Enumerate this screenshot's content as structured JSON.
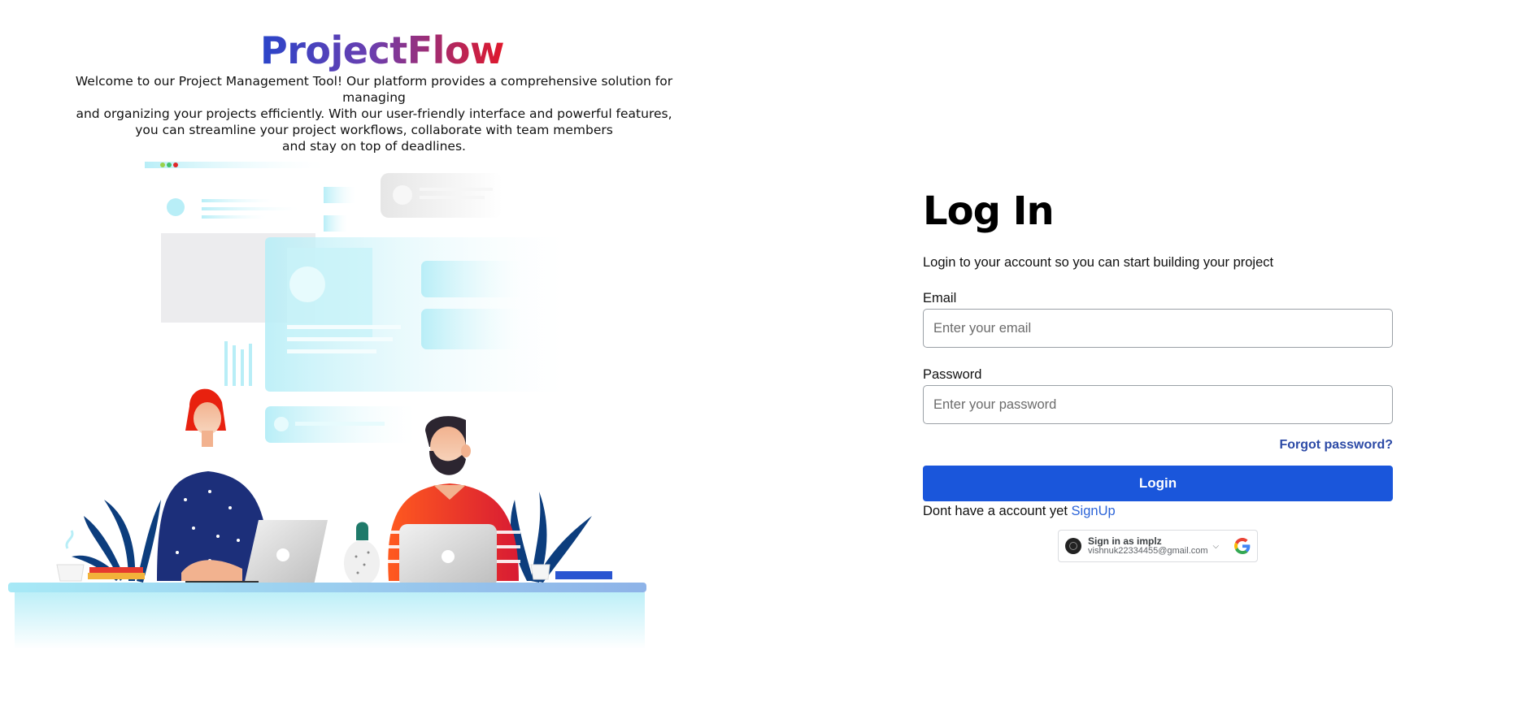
{
  "brand": {
    "name": "ProjectFlow",
    "gradient": [
      "#2a45c9",
      "#e0182b"
    ]
  },
  "intro": {
    "lines": [
      "Welcome to our Project Management Tool! Our platform provides a comprehensive solution for managing",
      "and organizing your projects efficiently. With our user-friendly interface and powerful features,",
      "you can streamline your project workflows, collaborate with team members",
      "and stay on top of deadlines."
    ]
  },
  "login": {
    "title": "Log In",
    "subtitle": "Login to your account so you can start building your project",
    "email_label": "Email",
    "email_placeholder": "Enter your email",
    "email_value": "",
    "password_label": "Password",
    "password_placeholder": "Enter your password",
    "password_value": "",
    "forgot_label": "Forgot password?",
    "button_label": "Login",
    "signup_prompt": "Dont have a account yet",
    "signup_label": "SignUp"
  },
  "google_signin": {
    "name_line": "Sign in as implz",
    "email": "vishnuk22334455@gmail.com",
    "icon": "google-icon"
  },
  "colors": {
    "primary_button": "#1a56db",
    "link": "#2c64d8",
    "forgot_link": "#2c4aa6"
  }
}
